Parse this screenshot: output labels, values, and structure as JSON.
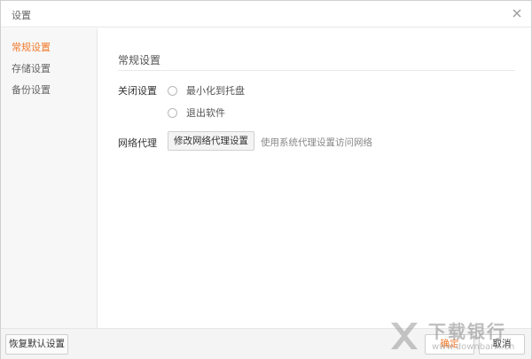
{
  "window": {
    "title": "设置"
  },
  "sidebar": {
    "items": [
      {
        "label": "常规设置",
        "active": true
      },
      {
        "label": "存储设置",
        "active": false
      },
      {
        "label": "备份设置",
        "active": false
      }
    ]
  },
  "main": {
    "section_title": "常规设置",
    "close_setting": {
      "label": "关闭设置",
      "options": [
        {
          "label": "最小化到托盘",
          "selected": false
        },
        {
          "label": "退出软件",
          "selected": false
        }
      ]
    },
    "network_proxy": {
      "label": "网络代理",
      "button_label": "修改网络代理设置",
      "hint": "使用系统代理设置访问网络"
    }
  },
  "footer": {
    "restore_label": "恢复默认设置",
    "ok_label": "确定",
    "cancel_label": "取消"
  },
  "watermark": {
    "name": "下载银行",
    "url": "www.downbank.cn"
  },
  "colors": {
    "accent": "#f07a2b",
    "sidebar_bg": "#f7f7f7",
    "border": "#e6e6e6"
  },
  "icons": {
    "close": "close-icon",
    "watermark_logo": "downbank-logo-icon"
  }
}
